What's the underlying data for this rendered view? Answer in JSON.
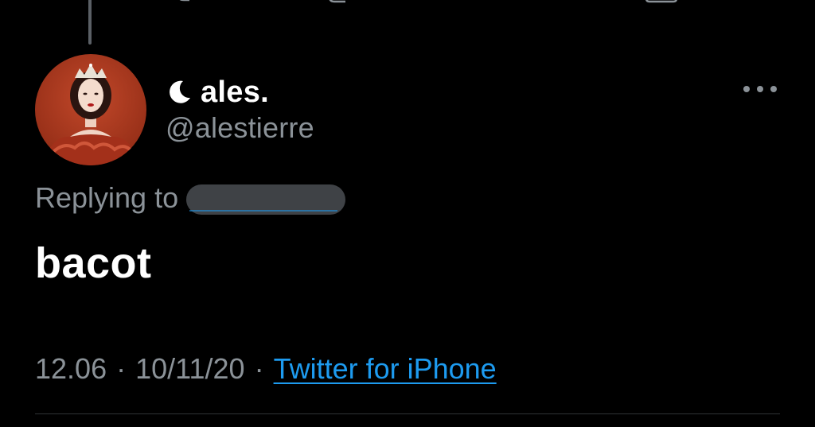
{
  "tweet": {
    "display_name": "ales.",
    "handle": "@alestierre",
    "replying_label": "Replying to",
    "text": "bacot",
    "time": "12.06",
    "date": "10/11/20",
    "separator": "·",
    "source": "Twitter for iPhone"
  },
  "icons": {
    "name_prefix": "moon-icon",
    "menu": "more-horizontal-icon",
    "top_actions": [
      "reply-icon",
      "retweet-icon",
      "like-icon",
      "share-icon"
    ]
  },
  "colors": {
    "background": "#000000",
    "primary_text": "#ffffff",
    "secondary_text": "#8b9298",
    "link": "#1d9bf0",
    "redaction": "#3f4246",
    "thread_line": "#5b6066",
    "divider": "#2f3336"
  }
}
